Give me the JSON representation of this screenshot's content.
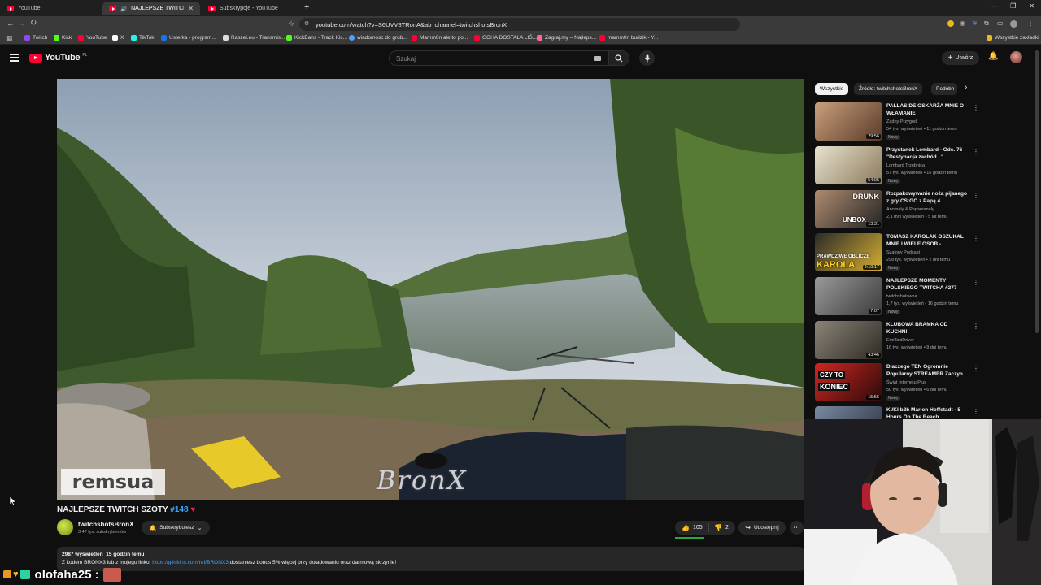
{
  "browser": {
    "tabs": [
      {
        "label": "YouTube",
        "active": false
      },
      {
        "label": "NAJLEPSZE TWITCH SZOTY #",
        "active": true
      },
      {
        "label": "Subskrypcje - YouTube",
        "active": false
      }
    ],
    "new_tab": "+",
    "url": "youtube.com/watch?v=S6UVV8TRonA&ab_channel=twitchshotsBronX",
    "bookmarks": [
      {
        "label": "Twitch",
        "color": "#9146ff"
      },
      {
        "label": "Kick",
        "color": "#53fc18"
      },
      {
        "label": "YouTube",
        "color": "#ff0033"
      },
      {
        "label": "X",
        "color": "#ffffff"
      },
      {
        "label": "TikTok",
        "color": "#25f4ee"
      },
      {
        "label": "Usterka - program...",
        "color": "#1a73e8"
      },
      {
        "label": "Raszei.eu - Transmis...",
        "color": "#dddddd"
      },
      {
        "label": "KickBans - Track Kic...",
        "color": "#53fc18"
      },
      {
        "label": "wiadomosc do grub...",
        "color": "#4fa3ff"
      },
      {
        "label": "Mamm0n ale to po...",
        "color": "#ff0033"
      },
      {
        "label": "GOHA DOSTAŁA LIŚ...",
        "color": "#ff0033"
      },
      {
        "label": "Zagraj.my – Najleps...",
        "color": "#ff6699"
      },
      {
        "label": "mamm0n budzik - Y...",
        "color": "#ff0033"
      }
    ],
    "all_bookmarks": "Wszystkie zakładki"
  },
  "youtube": {
    "logo_text": "YouTube",
    "region": "PL",
    "search_placeholder": "Szukaj",
    "create_label": "Utwórz"
  },
  "video": {
    "watermark_left": "remsua",
    "watermark_center": "BronX",
    "title": "NAJLEPSZE TWITCH SZOTY",
    "title_hash": "#148",
    "title_heart": "♥",
    "channel": "twitchshotsBronX",
    "subscribers": "3,47 tys. subskrybentów",
    "subscribe_label": "Subskrybujesz",
    "likes": "105",
    "dislikes": "2",
    "share_label": "Udostępnij",
    "views": "2987 wyświetleń",
    "posted": "15 godzin temu",
    "desc_prefix": "Z kodem BRONX3 lub z mojego linku:",
    "desc_link": "https://g4skins.com/ref/BRONX3",
    "desc_suffix": "dostaniesz bonus 5% więcej przy doładowaniu oraz darmową skrzynie!"
  },
  "sidebar": {
    "chips": [
      "Wszystkie",
      "Źródło: twitchshotsBronX",
      "Podobn"
    ],
    "recommendations": [
      {
        "title": "PALLASIDE OSKARŻA MNIE O WŁAMANIE",
        "channel": "Żądny Przygód",
        "meta": "54 tys. wyświetleń • 11 godzin temu",
        "badge": "Nowy",
        "duration": "29:56",
        "c1": "#c9a07a",
        "c2": "#5a3a2a"
      },
      {
        "title": "Przystanek Lombard - Odc. 76 \"Destynacja zachód...\"",
        "channel": "Lombard Trzebnica",
        "meta": "57 tys. wyświetleń • 16 godzin temu",
        "badge": "Nowy",
        "duration": "54:05",
        "c1": "#e7e2d0",
        "c2": "#8c7a5a"
      },
      {
        "title": "Rozpakowywanie noża pijanego z gry CS:GO z Papą 4",
        "channel": "Anomaly & Papanomaly",
        "meta": "2,1 mln wyświetleń • 5 lat temu",
        "badge": "",
        "duration": "13:31",
        "c1": "#b08c70",
        "c2": "#222222"
      },
      {
        "title": "TOMASZ KAROLAK OSZUKAŁ MNIE I WIELE OSÓB - ROBERT...",
        "channel": "Szalony Podcast",
        "meta": "298 tys. wyświetleń • 2 dni temu",
        "badge": "Nowy",
        "duration": "2:10:17",
        "c1": "#2a2a2a",
        "c2": "#d8b030"
      },
      {
        "title": "NAJLEPSZE MOMENTY POLSKIEGO TWITCHA #277",
        "channel": "twitchshotowna",
        "meta": "1,7 tys. wyświetleń • 16 godzin temu",
        "badge": "Nowy",
        "duration": "7:07",
        "c1": "#9a9a9a",
        "c2": "#3a3a3a"
      },
      {
        "title": "KLUBOWA BRAMKA OD KUCHNI",
        "channel": "EmiTaxiDriver",
        "meta": "16 tys. wyświetleń • 9 dni temu",
        "badge": "",
        "duration": "43:46",
        "c1": "#8a8478",
        "c2": "#2e2a24"
      },
      {
        "title": "Dlaczego TEN Ogromnie Popularny STREAMER Zaczyn...",
        "channel": "Świat Internetu Plus",
        "meta": "50 tys. wyświetleń • 6 dni temu",
        "badge": "Nowy",
        "duration": "15:55",
        "c1": "#d0271f",
        "c2": "#2a0a0a"
      },
      {
        "title": "KI/KI b2b Marlon Hoffstadt - 5 Hours On The Beach",
        "channel": "",
        "meta": "",
        "badge": "",
        "duration": "",
        "c1": "#7a8aa0",
        "c2": "#2a3040"
      }
    ],
    "thumb_texts": [
      "DRUNK",
      "UNBOX",
      "PRAWDZIWE OBLICZE",
      "KAROLA",
      "CZY TO",
      "KONIEC"
    ]
  },
  "stream_overlay": {
    "chat_user": "olofaha25 :"
  }
}
